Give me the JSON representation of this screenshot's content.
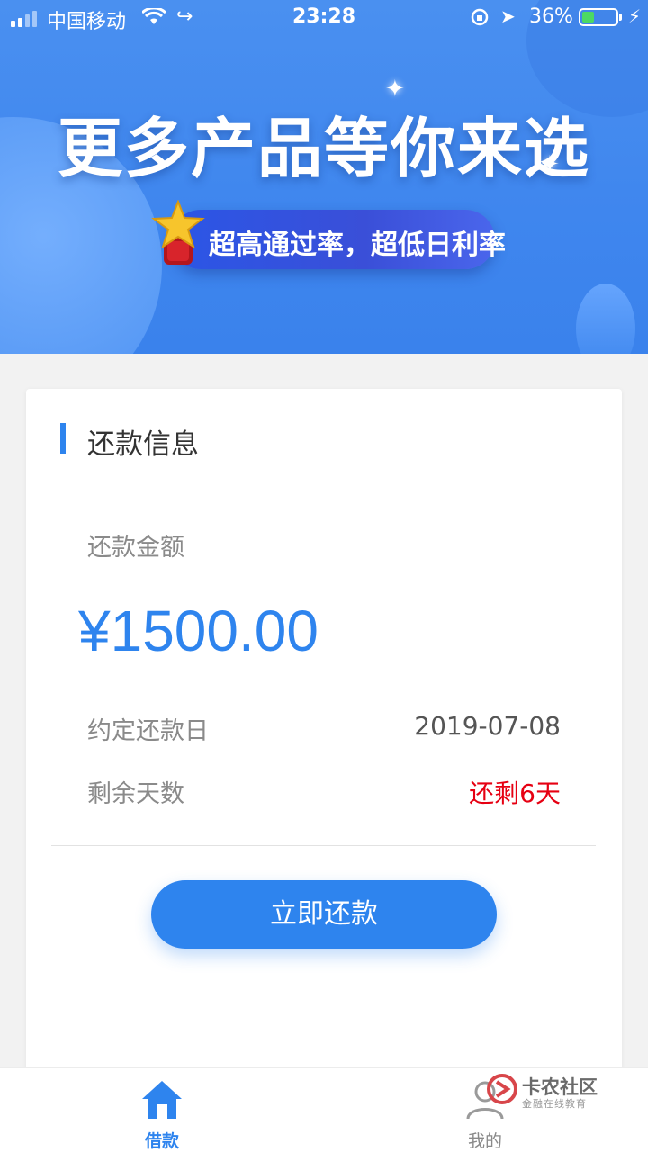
{
  "status_bar": {
    "carrier": "中国移动",
    "time": "23:28",
    "battery_percent": "36%"
  },
  "banner": {
    "headline": "更多产品等你来选",
    "subline": "超高通过率，超低日利率"
  },
  "repayment": {
    "section_title": "还款信息",
    "amount_label": "还款金额",
    "amount": "¥1500.00",
    "due_date_label": "约定还款日",
    "due_date": "2019-07-08",
    "remaining_label": "剩余天数",
    "remaining_value": "还剩6天",
    "repay_button": "立即还款"
  },
  "tabs": [
    {
      "label": "借款",
      "icon": "home-icon",
      "active": true
    },
    {
      "label": "我的",
      "icon": "user-icon",
      "active": false
    }
  ],
  "watermark": {
    "main": "卡农社区",
    "sub": "金融在线教育"
  },
  "colors": {
    "accent": "#2e84ee",
    "warning": "#e60012",
    "banner": "#4a90f0"
  }
}
